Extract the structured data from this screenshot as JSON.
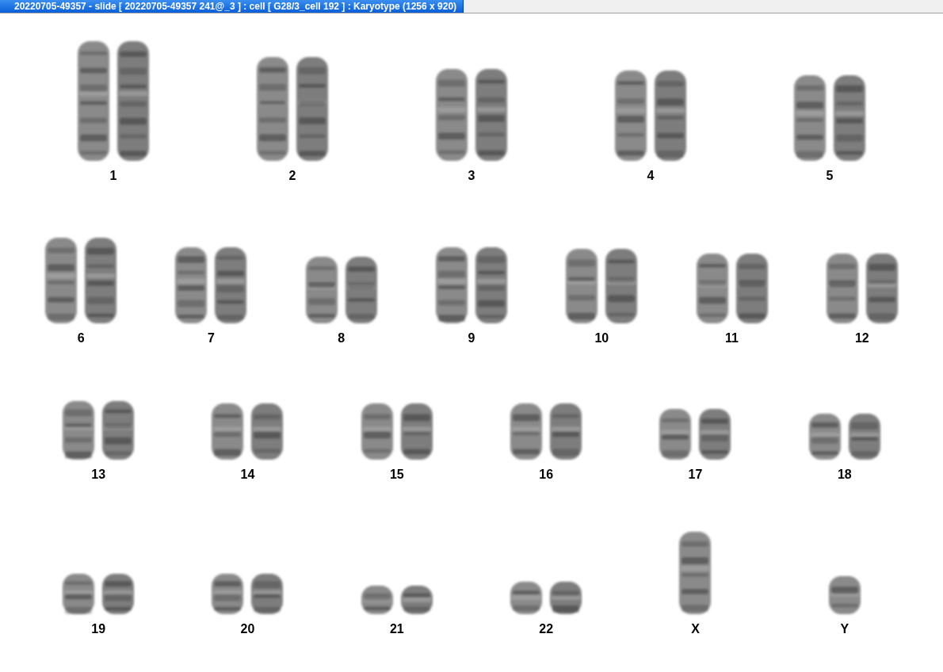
{
  "window": {
    "title": "20220705-49357 - slide [ 20220705-49357 241@_3 ] : cell [ G28/3_cell 192 ] : Karyotype  (1256 x 920)"
  },
  "karyotype": {
    "rows": [
      {
        "chromosomes": [
          {
            "label": "1",
            "kind": "pair"
          },
          {
            "label": "2",
            "kind": "pair"
          },
          {
            "label": "3",
            "kind": "pair"
          },
          {
            "label": "4",
            "kind": "pair"
          },
          {
            "label": "5",
            "kind": "pair"
          }
        ]
      },
      {
        "chromosomes": [
          {
            "label": "6",
            "kind": "pair"
          },
          {
            "label": "7",
            "kind": "pair"
          },
          {
            "label": "8",
            "kind": "pair"
          },
          {
            "label": "9",
            "kind": "pair"
          },
          {
            "label": "10",
            "kind": "pair"
          },
          {
            "label": "11",
            "kind": "pair"
          },
          {
            "label": "12",
            "kind": "pair"
          }
        ]
      },
      {
        "chromosomes": [
          {
            "label": "13",
            "kind": "pair"
          },
          {
            "label": "14",
            "kind": "pair"
          },
          {
            "label": "15",
            "kind": "pair"
          },
          {
            "label": "16",
            "kind": "pair"
          },
          {
            "label": "17",
            "kind": "pair"
          },
          {
            "label": "18",
            "kind": "pair"
          }
        ]
      },
      {
        "chromosomes": [
          {
            "label": "19",
            "kind": "pair"
          },
          {
            "label": "20",
            "kind": "pair"
          },
          {
            "label": "21",
            "kind": "pair"
          },
          {
            "label": "22",
            "kind": "pair"
          },
          {
            "label": "X",
            "kind": "single"
          },
          {
            "label": "Y",
            "kind": "single"
          }
        ]
      }
    ]
  }
}
